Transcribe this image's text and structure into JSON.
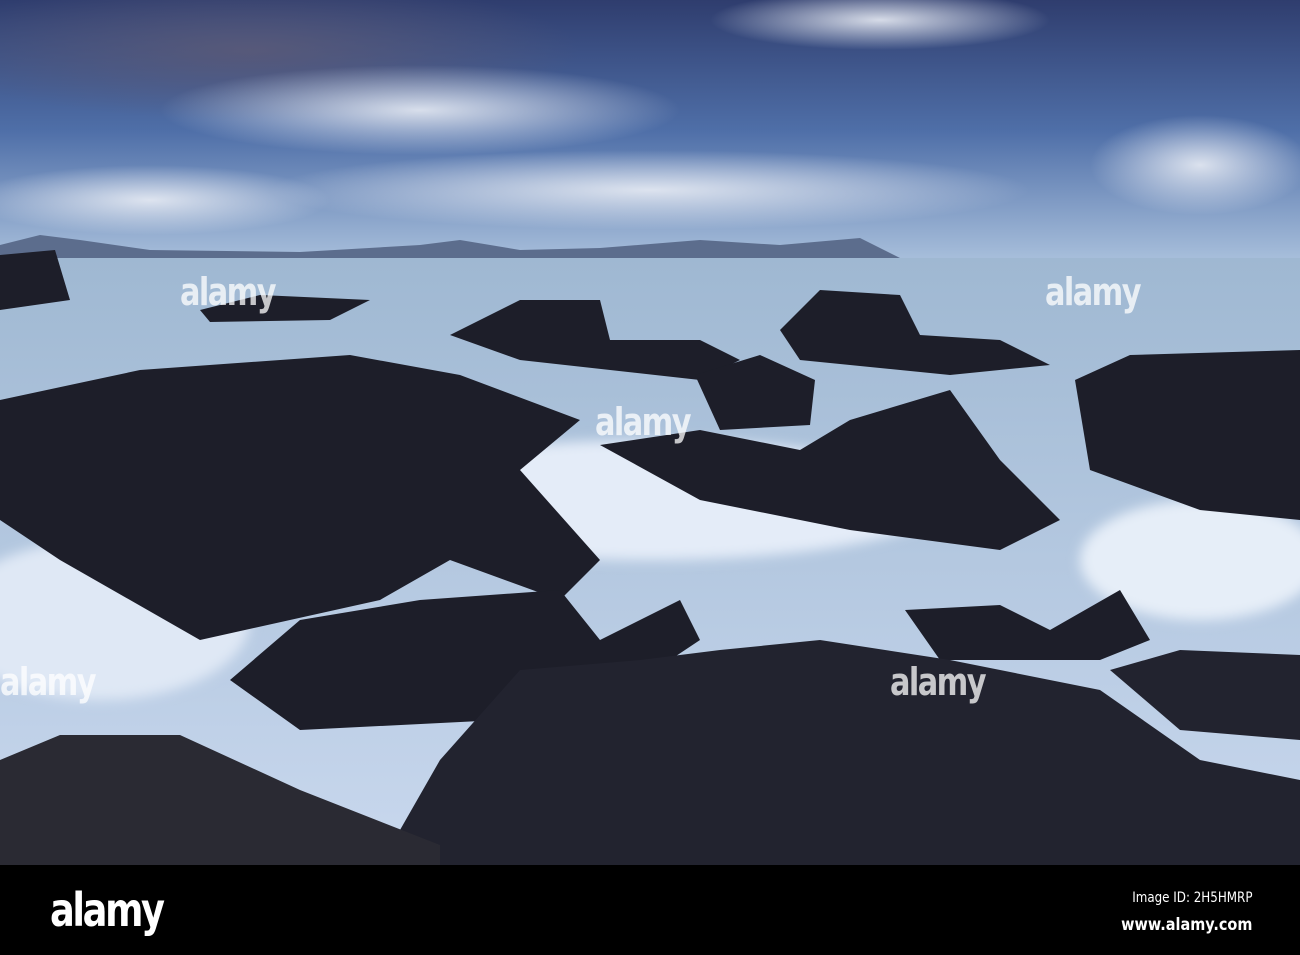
{
  "watermark": {
    "text": "alamy"
  },
  "footer": {
    "logo": "alamy",
    "image_id": "Image ID: 2H5HMRP",
    "url": "www.alamy.com"
  }
}
